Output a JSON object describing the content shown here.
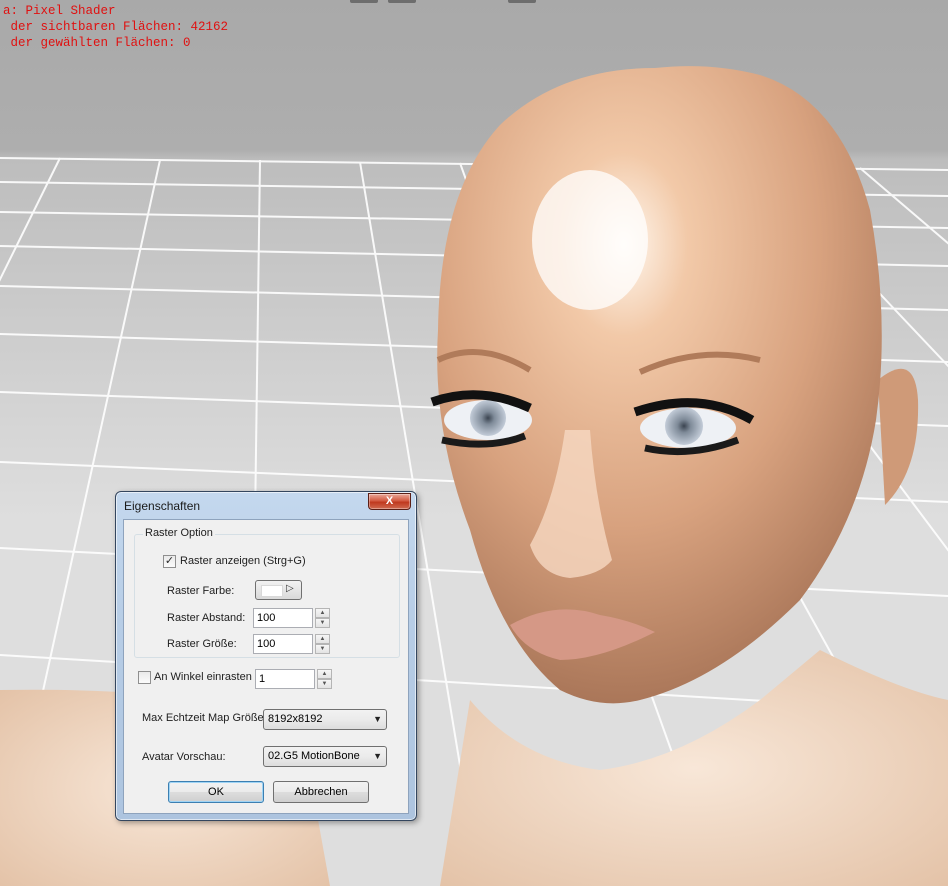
{
  "overlay": {
    "line1": "a: Pixel Shader",
    "line2": " der sichtbaren Flächen: 42162",
    "line3": " der gewählten Flächen: 0"
  },
  "dialog": {
    "title": "Eigenschaften",
    "close_label": "X",
    "raster_group": {
      "legend": "Raster Option",
      "show_grid_label": "Raster anzeigen (Strg+G)",
      "show_grid_checked": true,
      "grid_color_label": "Raster Farbe:",
      "grid_color": "#ffffff",
      "grid_spacing_label": "Raster Abstand:",
      "grid_spacing_value": "100",
      "grid_size_label": "Raster Größe:",
      "grid_size_value": "100"
    },
    "snap_angle_label": "An Winkel einrasten",
    "snap_angle_checked": false,
    "snap_angle_value": "1",
    "max_map_label": "Max Echtzeit Map Größe:",
    "max_map_value": "8192x8192",
    "avatar_preview_label": "Avatar Vorschau:",
    "avatar_preview_value": "02.G5 MotionBone",
    "ok_label": "OK",
    "cancel_label": "Abbrechen"
  },
  "colors": {
    "overlay_text": "#e01010",
    "dialog_frame": "#b7cde6",
    "close_button": "#c8452b"
  }
}
